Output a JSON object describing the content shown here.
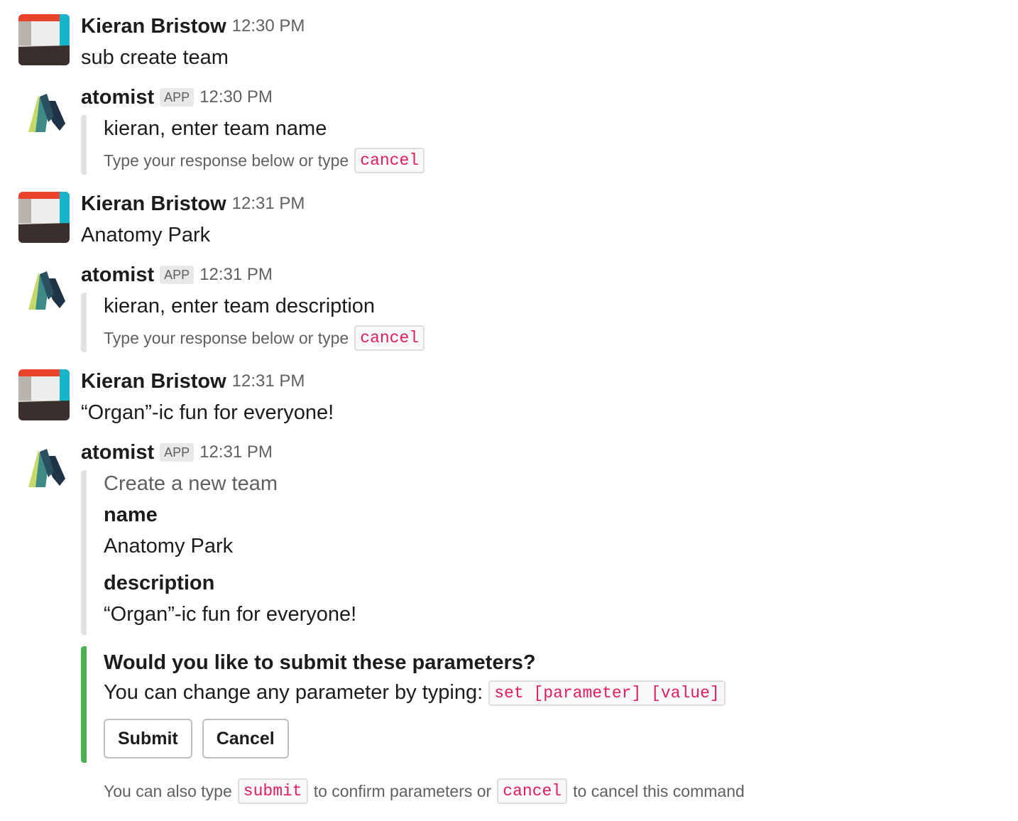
{
  "messages": [
    {
      "author": "Kieran Bristow",
      "time": "12:30 PM",
      "text": "sub create team"
    },
    {
      "author": "atomist",
      "badge": "APP",
      "time": "12:30 PM",
      "title": "kieran, enter team name",
      "hint": "Type your response below or type",
      "hint_code": "cancel"
    },
    {
      "author": "Kieran Bristow",
      "time": "12:31 PM",
      "text": "Anatomy Park"
    },
    {
      "author": "atomist",
      "badge": "APP",
      "time": "12:31 PM",
      "title": "kieran, enter team description",
      "hint": "Type your response below or type",
      "hint_code": "cancel"
    },
    {
      "author": "Kieran Bristow",
      "time": "12:31 PM",
      "text": "“Organ”-ic fun for everyone!"
    },
    {
      "author": "atomist",
      "badge": "APP",
      "time": "12:31 PM",
      "pretext": "Create a new team",
      "fields": [
        {
          "title": "name",
          "value": "Anatomy Park"
        },
        {
          "title": "description",
          "value": "“Organ”-ic fun for everyone!"
        }
      ],
      "confirm_title": "Would you like to submit these parameters?",
      "confirm_text": "You can change any parameter by typing:",
      "confirm_code": "set [parameter] [value]",
      "buttons": {
        "submit": "Submit",
        "cancel": "Cancel"
      },
      "footer": {
        "part1": "You can also type",
        "code1": "submit",
        "part2": "to confirm parameters or",
        "code2": "cancel",
        "part3": "to cancel this command"
      }
    }
  ],
  "colors": {
    "accent_green": "#4caf50",
    "code_red": "#e01e5a",
    "attachment_gray": "#e2e2e2"
  },
  "icons": {
    "user_avatar": "kieran-avatar",
    "bot_avatar": "atomist-logo-icon"
  }
}
